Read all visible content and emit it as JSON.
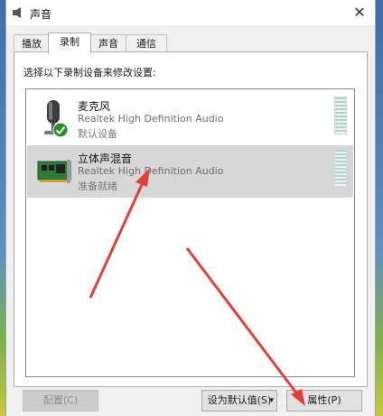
{
  "window": {
    "title": "声音",
    "close_glyph": "✕"
  },
  "tabs": [
    {
      "label": "播放",
      "active": false
    },
    {
      "label": "录制",
      "active": true
    },
    {
      "label": "声音",
      "active": false
    },
    {
      "label": "通信",
      "active": false
    }
  ],
  "instruction": "选择以下录制设备来修改设置:",
  "devices": [
    {
      "name": "麦克风",
      "description": "Realtek High Definition Audio",
      "status": "默认设备",
      "icon": "microphone-icon",
      "default_badge": "check-badge-icon",
      "selected": false
    },
    {
      "name": "立体声混音",
      "description": "Realtek High Definition Audio",
      "status": "准备就绪",
      "icon": "sound-card-icon",
      "selected": true
    }
  ],
  "buttons": {
    "configure": "配置(C)",
    "set_default": "设为默认值(S)",
    "properties": "属性(P)"
  },
  "colors": {
    "annotation_arrow": "#e0403a",
    "selected_row": "#d7d7d7"
  }
}
